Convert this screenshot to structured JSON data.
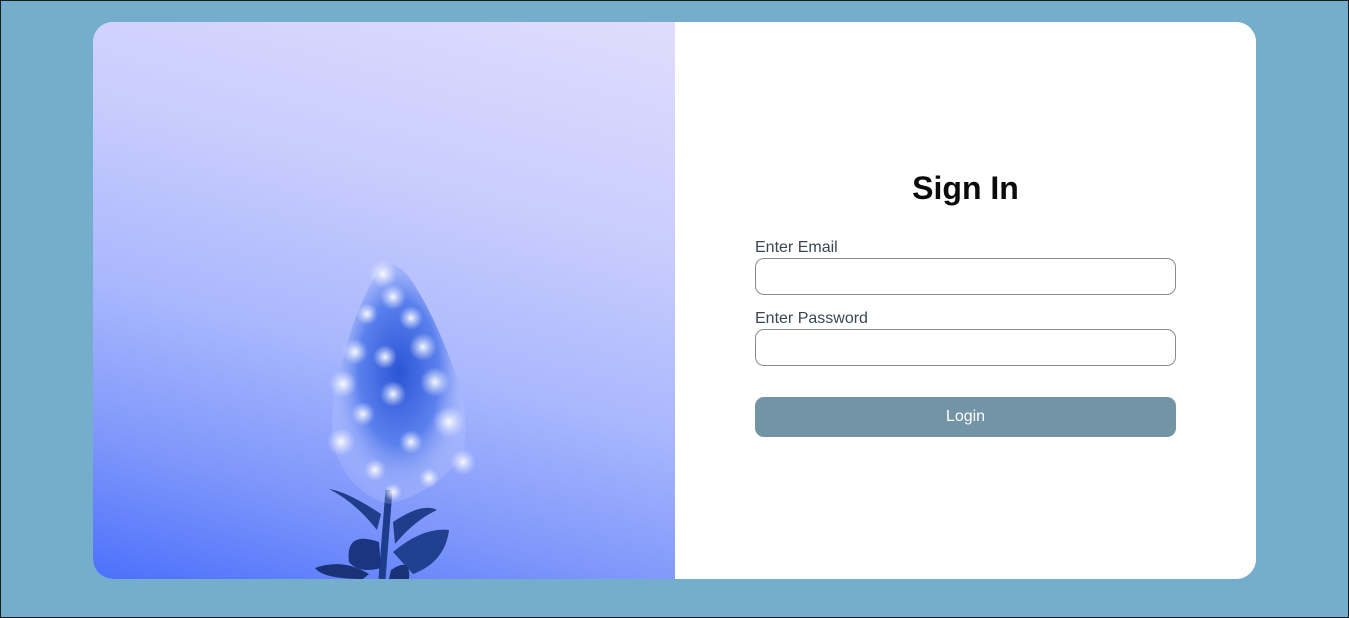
{
  "colors": {
    "page_background": "#75adcd",
    "card_background": "#ffffff",
    "button_background": "#7294a5",
    "button_text": "#ffffff",
    "label_text": "#3b4653",
    "title_text": "#0b0b0b"
  },
  "hero_image": {
    "icon": "flower-photo"
  },
  "form": {
    "title": "Sign In",
    "email": {
      "label": "Enter Email",
      "value": ""
    },
    "password": {
      "label": "Enter Password",
      "value": ""
    },
    "login_label": "Login"
  }
}
